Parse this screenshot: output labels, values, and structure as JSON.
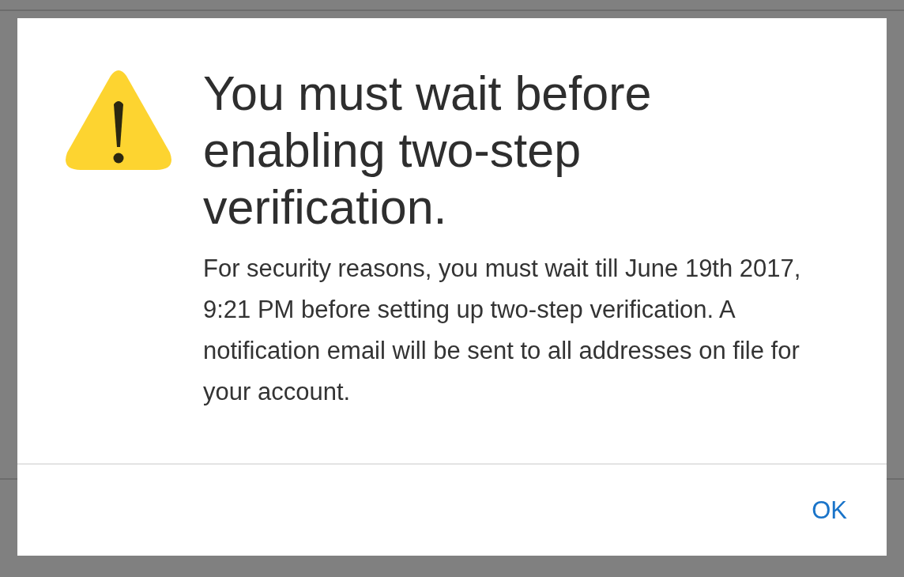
{
  "dialog": {
    "title": "You must wait before enabling two-step verification.",
    "message": "For security reasons, you must wait till June 19th 2017, 9:21 PM before setting up two-step verification. A notification email will be sent to all addresses on file for your account.",
    "buttons": [
      "OK"
    ]
  }
}
